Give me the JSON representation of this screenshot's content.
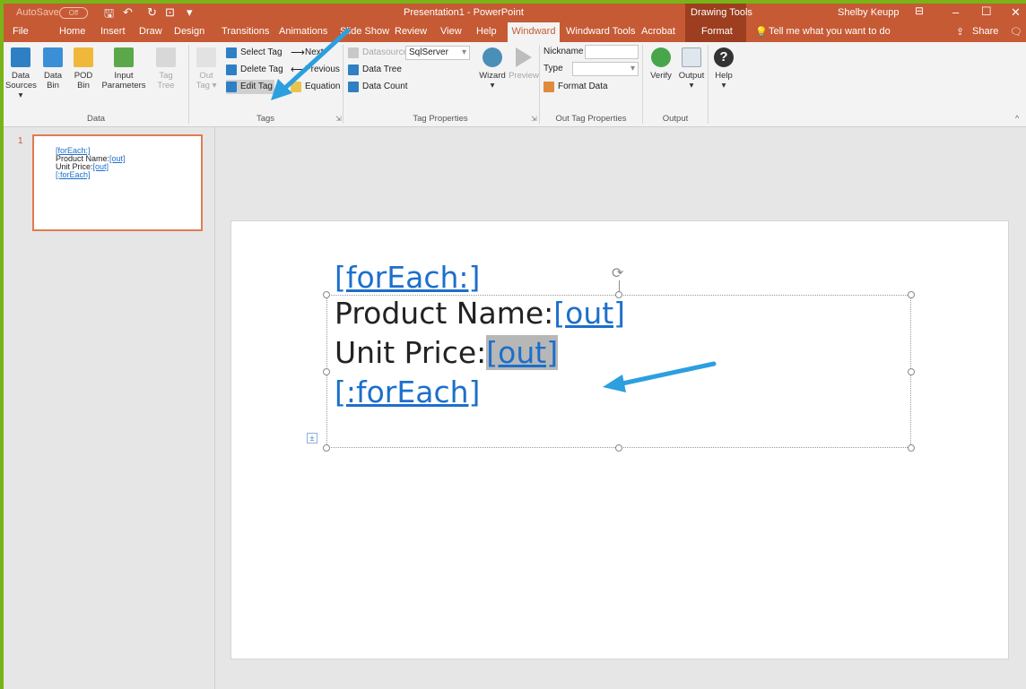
{
  "titlebar": {
    "autosave": "AutoSave",
    "autosave_state": "Off",
    "title": "Presentation1 - PowerPoint",
    "context": "Drawing Tools",
    "user": "Shelby Keupp"
  },
  "tabs": [
    "File",
    "Home",
    "Insert",
    "Draw",
    "Design",
    "Transitions",
    "Animations",
    "Slide Show",
    "Review",
    "View",
    "Help",
    "Windward",
    "Windward Tools",
    "Acrobat",
    "Format"
  ],
  "tell_me": "Tell me what you want to do",
  "share": "Share",
  "ribbon": {
    "data_group": {
      "label": "Data",
      "buttons": [
        {
          "l1": "Data",
          "l2": "Sources ▾"
        },
        {
          "l1": "Data",
          "l2": "Bin"
        },
        {
          "l1": "POD",
          "l2": "Bin"
        },
        {
          "l1": "Input",
          "l2": "Parameters"
        },
        {
          "l1": "Tag",
          "l2": "Tree"
        }
      ]
    },
    "tags_group": {
      "label": "Tags",
      "out_tag": {
        "l1": "Out",
        "l2": "Tag ▾"
      },
      "select_tag": "Select Tag",
      "delete_tag": "Delete Tag",
      "edit_tag": "Edit Tag",
      "next": "Next",
      "previous": "Previous",
      "equation": "Equation"
    },
    "tag_props_group": {
      "label": "Tag Properties",
      "datasource_label": "Datasource",
      "datasource_value": "SqlServer",
      "data_tree": "Data Tree",
      "data_count": "Data Count",
      "wizard": "Wizard",
      "preview": "Preview"
    },
    "out_tag_props_group": {
      "label": "Out Tag Properties",
      "nickname_label": "Nickname",
      "type_label": "Type",
      "format_data": "Format Data"
    },
    "output_group": {
      "label": "Output",
      "verify": "Verify",
      "output": "Output"
    },
    "help": "Help"
  },
  "thumbnail": {
    "number": "1",
    "line1_link": "[forEach:]",
    "line2_text": "Product Name:",
    "line2_link": "[out]",
    "line3_text": "Unit Price:",
    "line3_link": "[out]",
    "line4_link": "[:forEach]"
  },
  "slide": {
    "line1_link": "[forEach:]",
    "line2_text": "Product Name:",
    "line2_link": "[out]",
    "line3_text": "Unit Price:",
    "line3_link": "[out]",
    "line4_link": "[:forEach]"
  },
  "colors": {
    "accent": "#c55a35",
    "link": "#1c6fcc",
    "arrow": "#2b9fe0"
  }
}
